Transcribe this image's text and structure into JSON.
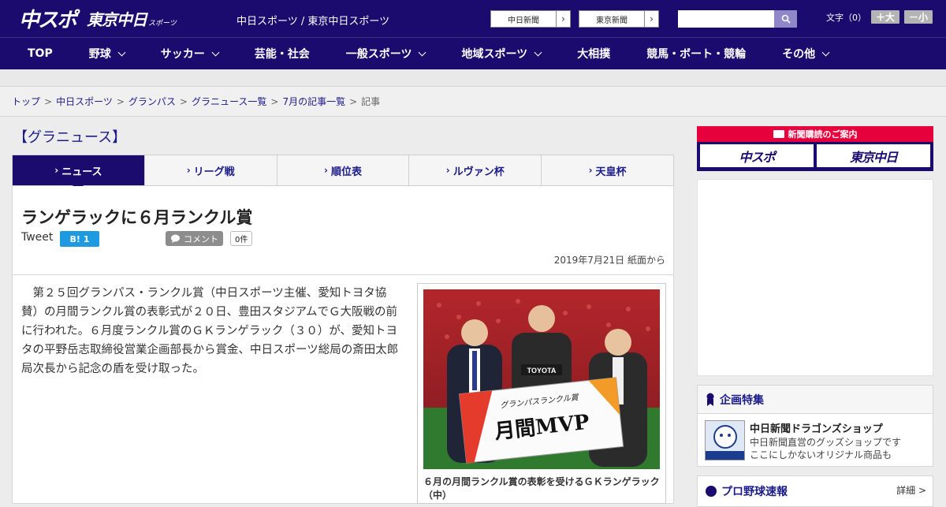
{
  "header": {
    "logo_main": "中スポ",
    "logo_tokyo": "東京中日",
    "logo_sports": "スポーツ",
    "site_tag": "中日スポーツ / 東京中日スポーツ",
    "paper_buttons": [
      "中日新聞",
      "東京新聞"
    ],
    "search_placeholder": "",
    "fontsize_label": "文字（0）",
    "font_larger": "＋大",
    "font_smaller": "－小"
  },
  "nav": {
    "items": [
      {
        "label": "TOP"
      },
      {
        "label": "野球"
      },
      {
        "label": "サッカー"
      },
      {
        "label": "芸能・社会"
      },
      {
        "label": "一般スポーツ"
      },
      {
        "label": "地域スポーツ"
      },
      {
        "label": "大相撲"
      },
      {
        "label": "競馬・ボート・競輪"
      },
      {
        "label": "その他"
      }
    ]
  },
  "breadcrumb": {
    "items": [
      "トップ",
      "中日スポーツ",
      "グランパス",
      "グラニュース一覧",
      "7月の記事一覧"
    ],
    "current": "記事"
  },
  "section": {
    "title": "【グラニュース】",
    "tabs": [
      "ニュース",
      "リーグ戦",
      "順位表",
      "ルヴァン杯",
      "天皇杯"
    ]
  },
  "article": {
    "title": "ランゲラックに６月ランクル賞",
    "tweet_label": "Tweet",
    "hatena_label": "B! 1",
    "comment_label": "コメント",
    "comment_count": "0件",
    "date": "2019年7月21日 紙面から",
    "body": "第２５回グランパス・ランクル賞（中日スポーツ主催、愛知トヨタ協賛）の月間ランクル賞の表彰式が２０日、豊田スタジアムでＧ大阪戦の前に行われた。６月度ランクル賞のＧＫランゲラック（３０）が、愛知トヨタの平野岳志取締役営業企画部長から賞金、中日スポーツ総局の斎田太郎局次長から記念の盾を受け取った。",
    "photo_board_text": "月間MVP",
    "photo_board_sub": "グランパスランクル賞",
    "caption": "６月の月間ランクル賞の表彰を受けるＧＫランゲラック（中）"
  },
  "sidebar": {
    "subscribe_strip": "新聞購読のご案内",
    "subscribe_logos": [
      "中スポ",
      "東京中日"
    ],
    "feature_title": "企画特集",
    "feature_item_title": "中日新聞ドラゴンズショップ",
    "feature_item_desc_1": "中日新聞直営のグッズショップです",
    "feature_item_desc_2": "ここにしかないオリジナル商品も",
    "baseball_title": "プロ野球速報",
    "baseball_more": "詳細 >"
  }
}
